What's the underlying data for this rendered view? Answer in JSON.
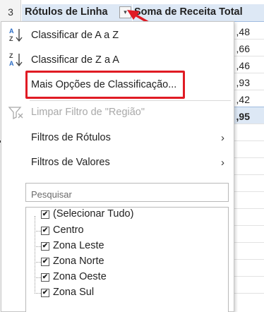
{
  "sheet": {
    "visible_row_number": "3",
    "column_a_header": "Rótulos de Linha",
    "column_b_header": "Soma de Receita Total",
    "filter_button_symbol": "▾",
    "partial_values": [
      ",48",
      ",66",
      ",46",
      ",93",
      ",42",
      ",95"
    ],
    "colors": {
      "header_fill": "#dde8f5",
      "callout_red": "#e01b24"
    }
  },
  "menu": {
    "sort_az": "Classificar de A a Z",
    "sort_za": "Classificar de Z a A",
    "more_sort_options": "Mais Opções de Classificação...",
    "clear_filter": "Limpar Filtro de \"Região\"",
    "label_filters": "Filtros de Rótulos",
    "value_filters": "Filtros de Valores",
    "submenu_chevron": "›",
    "search_placeholder": "Pesquisar",
    "checklist": [
      {
        "label": "(Selecionar Tudo)",
        "checked": true
      },
      {
        "label": "Centro",
        "checked": true
      },
      {
        "label": "Zona Leste",
        "checked": true
      },
      {
        "label": "Zona Norte",
        "checked": true
      },
      {
        "label": "Zona Oeste",
        "checked": true
      },
      {
        "label": "Zona Sul",
        "checked": true
      }
    ],
    "check_mark": "✔",
    "icons": {
      "sort_az": "sort-ascending-icon",
      "sort_za": "sort-descending-icon",
      "clear_filter": "clear-filter-icon"
    }
  }
}
